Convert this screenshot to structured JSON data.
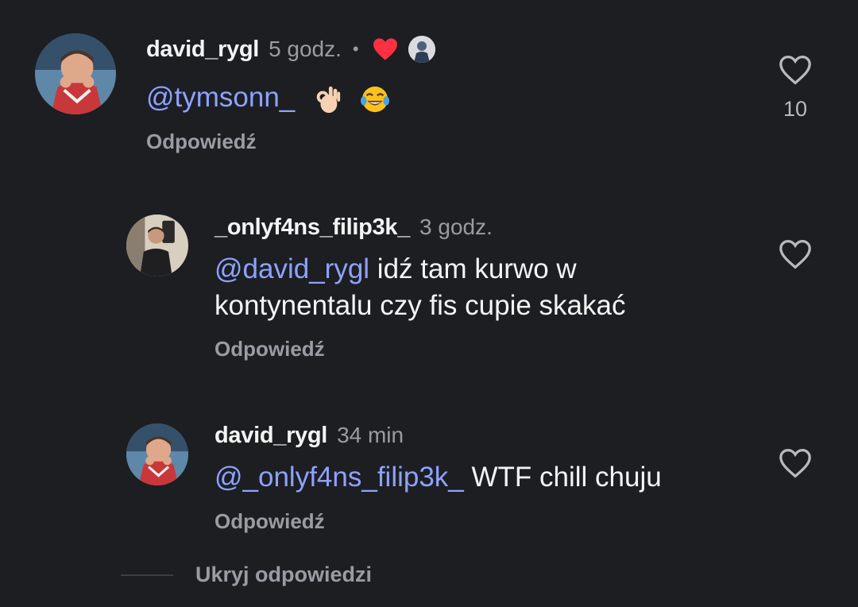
{
  "comments": [
    {
      "username": "david_rygl",
      "time": "5 godz.",
      "separator": "•",
      "mention": "@tymsonn_",
      "text": "",
      "emojis": [
        "ok-hand-emoji",
        "tears-of-joy-emoji"
      ],
      "reply_label": "Odpowiedź",
      "like_count": "10",
      "liked_by_author": true
    },
    {
      "username": "_onlyf4ns_filip3k_",
      "time": "3 godz.",
      "mention": "@david_rygl",
      "text_line1": " idź tam kurwo w",
      "text_line2": "kontynentalu czy fis cupie skakać",
      "reply_label": "Odpowiedź"
    },
    {
      "username": "david_rygl",
      "time": "34 min",
      "mention": "@_onlyf4ns_filip3k_",
      "text": " WTF chill chuju",
      "reply_label": "Odpowiedź"
    }
  ],
  "hide_replies_label": "Ukryj odpowiedzi",
  "colors": {
    "background": "#1d1e22",
    "mention": "#8da2ff",
    "secondary_text": "#9a9ca3",
    "heart": "#ff3040"
  }
}
